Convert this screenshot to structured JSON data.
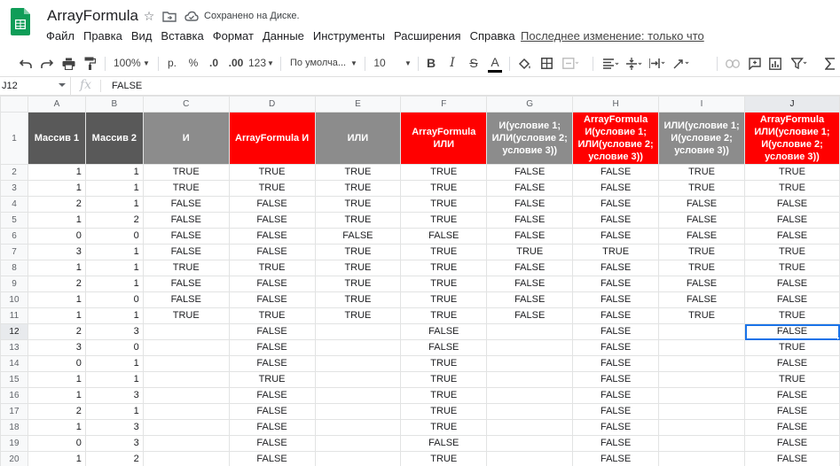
{
  "app": {
    "doc_title": "ArrayFormula",
    "save_status": "Сохранено на Диске.",
    "last_edit": "Последнее изменение: только что",
    "brand_color": "#0f9d58"
  },
  "menu": [
    "Файл",
    "Правка",
    "Вид",
    "Вставка",
    "Формат",
    "Данные",
    "Инструменты",
    "Расширения",
    "Справка"
  ],
  "toolbar": {
    "zoom": "100%",
    "currency": "р.",
    "percent": "%",
    "decimal_less": ".0",
    "decimal_more": ".00",
    "number_format": "123",
    "font": "По умолча...",
    "font_size": "10",
    "bold": "B",
    "italic": "I",
    "strike": "S",
    "text_color": "A"
  },
  "formula_bar": {
    "cell_ref": "J12",
    "fx": "fx",
    "value": "FALSE"
  },
  "sheet": {
    "columns": [
      "A",
      "B",
      "C",
      "D",
      "E",
      "F",
      "G",
      "H",
      "I",
      "J"
    ],
    "header_row_number": "1",
    "headers": [
      "Массив 1",
      "Массив 2",
      "И",
      "ArrayFormula И",
      "ИЛИ",
      "ArrayFormula ИЛИ",
      "И(условие 1; ИЛИ(условие 2; условие 3))",
      "ArrayFormula И(условие 1; ИЛИ(условие 2; условие 3))",
      "ИЛИ(условие 1; И(условие 2; условие 3))",
      "ArrayFormula ИЛИ(условие 1; И(условие 2; условие 3))"
    ],
    "rows": [
      {
        "n": "2",
        "cells": [
          "1",
          "1",
          "TRUE",
          "TRUE",
          "TRUE",
          "TRUE",
          "FALSE",
          "FALSE",
          "TRUE",
          "TRUE"
        ]
      },
      {
        "n": "3",
        "cells": [
          "1",
          "1",
          "TRUE",
          "TRUE",
          "TRUE",
          "TRUE",
          "FALSE",
          "FALSE",
          "TRUE",
          "TRUE"
        ]
      },
      {
        "n": "4",
        "cells": [
          "2",
          "1",
          "FALSE",
          "FALSE",
          "TRUE",
          "TRUE",
          "FALSE",
          "FALSE",
          "FALSE",
          "FALSE"
        ]
      },
      {
        "n": "5",
        "cells": [
          "1",
          "2",
          "FALSE",
          "FALSE",
          "TRUE",
          "TRUE",
          "FALSE",
          "FALSE",
          "FALSE",
          "FALSE"
        ]
      },
      {
        "n": "6",
        "cells": [
          "0",
          "0",
          "FALSE",
          "FALSE",
          "FALSE",
          "FALSE",
          "FALSE",
          "FALSE",
          "FALSE",
          "FALSE"
        ]
      },
      {
        "n": "7",
        "cells": [
          "3",
          "1",
          "FALSE",
          "FALSE",
          "TRUE",
          "TRUE",
          "TRUE",
          "TRUE",
          "TRUE",
          "TRUE"
        ]
      },
      {
        "n": "8",
        "cells": [
          "1",
          "1",
          "TRUE",
          "TRUE",
          "TRUE",
          "TRUE",
          "FALSE",
          "FALSE",
          "TRUE",
          "TRUE"
        ]
      },
      {
        "n": "9",
        "cells": [
          "2",
          "1",
          "FALSE",
          "FALSE",
          "TRUE",
          "TRUE",
          "FALSE",
          "FALSE",
          "FALSE",
          "FALSE"
        ]
      },
      {
        "n": "10",
        "cells": [
          "1",
          "0",
          "FALSE",
          "FALSE",
          "TRUE",
          "TRUE",
          "FALSE",
          "FALSE",
          "FALSE",
          "FALSE"
        ]
      },
      {
        "n": "11",
        "cells": [
          "1",
          "1",
          "TRUE",
          "TRUE",
          "TRUE",
          "TRUE",
          "FALSE",
          "FALSE",
          "TRUE",
          "TRUE"
        ]
      },
      {
        "n": "12",
        "cells": [
          "2",
          "3",
          "",
          "FALSE",
          "",
          "FALSE",
          "",
          "FALSE",
          "",
          "FALSE"
        ]
      },
      {
        "n": "13",
        "cells": [
          "3",
          "0",
          "",
          "FALSE",
          "",
          "FALSE",
          "",
          "FALSE",
          "",
          "TRUE"
        ]
      },
      {
        "n": "14",
        "cells": [
          "0",
          "1",
          "",
          "FALSE",
          "",
          "TRUE",
          "",
          "FALSE",
          "",
          "FALSE"
        ]
      },
      {
        "n": "15",
        "cells": [
          "1",
          "1",
          "",
          "TRUE",
          "",
          "TRUE",
          "",
          "FALSE",
          "",
          "TRUE"
        ]
      },
      {
        "n": "16",
        "cells": [
          "1",
          "3",
          "",
          "FALSE",
          "",
          "TRUE",
          "",
          "FALSE",
          "",
          "FALSE"
        ]
      },
      {
        "n": "17",
        "cells": [
          "2",
          "1",
          "",
          "FALSE",
          "",
          "TRUE",
          "",
          "FALSE",
          "",
          "FALSE"
        ]
      },
      {
        "n": "18",
        "cells": [
          "1",
          "3",
          "",
          "FALSE",
          "",
          "TRUE",
          "",
          "FALSE",
          "",
          "FALSE"
        ]
      },
      {
        "n": "19",
        "cells": [
          "0",
          "3",
          "",
          "FALSE",
          "",
          "FALSE",
          "",
          "FALSE",
          "",
          "FALSE"
        ]
      },
      {
        "n": "20",
        "cells": [
          "1",
          "2",
          "",
          "FALSE",
          "",
          "TRUE",
          "",
          "FALSE",
          "",
          "FALSE"
        ]
      }
    ],
    "header_colors": {
      "dark": "#595959",
      "gray": "#8c8c8c",
      "red": "#ff0000"
    },
    "selected_cell": "J12"
  }
}
